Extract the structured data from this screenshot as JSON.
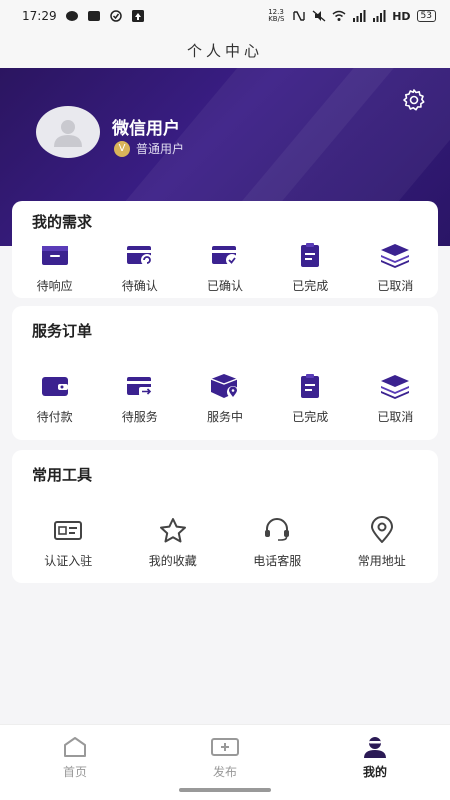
{
  "status": {
    "time": "17:29",
    "speed": "12.3 KB/S",
    "network": "HD",
    "battery": "53"
  },
  "header": {
    "title": "个人中心"
  },
  "profile": {
    "name": "微信用户",
    "level": "普通用户",
    "level_badge": "V"
  },
  "needs": {
    "title": "我的需求",
    "items": [
      {
        "label": "待响应",
        "icon": "inbox-icon"
      },
      {
        "label": "待确认",
        "icon": "card-refresh-icon"
      },
      {
        "label": "已确认",
        "icon": "card-check-icon"
      },
      {
        "label": "已完成",
        "icon": "clipboard-icon"
      },
      {
        "label": "已取消",
        "icon": "layers-icon"
      }
    ]
  },
  "orders": {
    "title": "服务订单",
    "items": [
      {
        "label": "待付款",
        "icon": "wallet-icon"
      },
      {
        "label": "待服务",
        "icon": "card-send-icon"
      },
      {
        "label": "服务中",
        "icon": "box-location-icon"
      },
      {
        "label": "已完成",
        "icon": "clipboard-icon"
      },
      {
        "label": "已取消",
        "icon": "layers-icon"
      }
    ]
  },
  "tools": {
    "title": "常用工具",
    "items": [
      {
        "label": "认证入驻",
        "icon": "id-card-icon"
      },
      {
        "label": "我的收藏",
        "icon": "star-icon"
      },
      {
        "label": "电话客服",
        "icon": "headset-icon"
      },
      {
        "label": "常用地址",
        "icon": "location-pin-icon"
      }
    ]
  },
  "tabbar": {
    "items": [
      {
        "label": "首页",
        "icon": "home-icon",
        "active": false
      },
      {
        "label": "发布",
        "icon": "add-box-icon",
        "active": false
      },
      {
        "label": "我的",
        "icon": "user-icon",
        "active": true
      }
    ]
  },
  "colors": {
    "brand": "#3b2290",
    "hero_start": "#2b1560",
    "hero_end": "#3a1e86",
    "badge": "#d9b45a"
  }
}
